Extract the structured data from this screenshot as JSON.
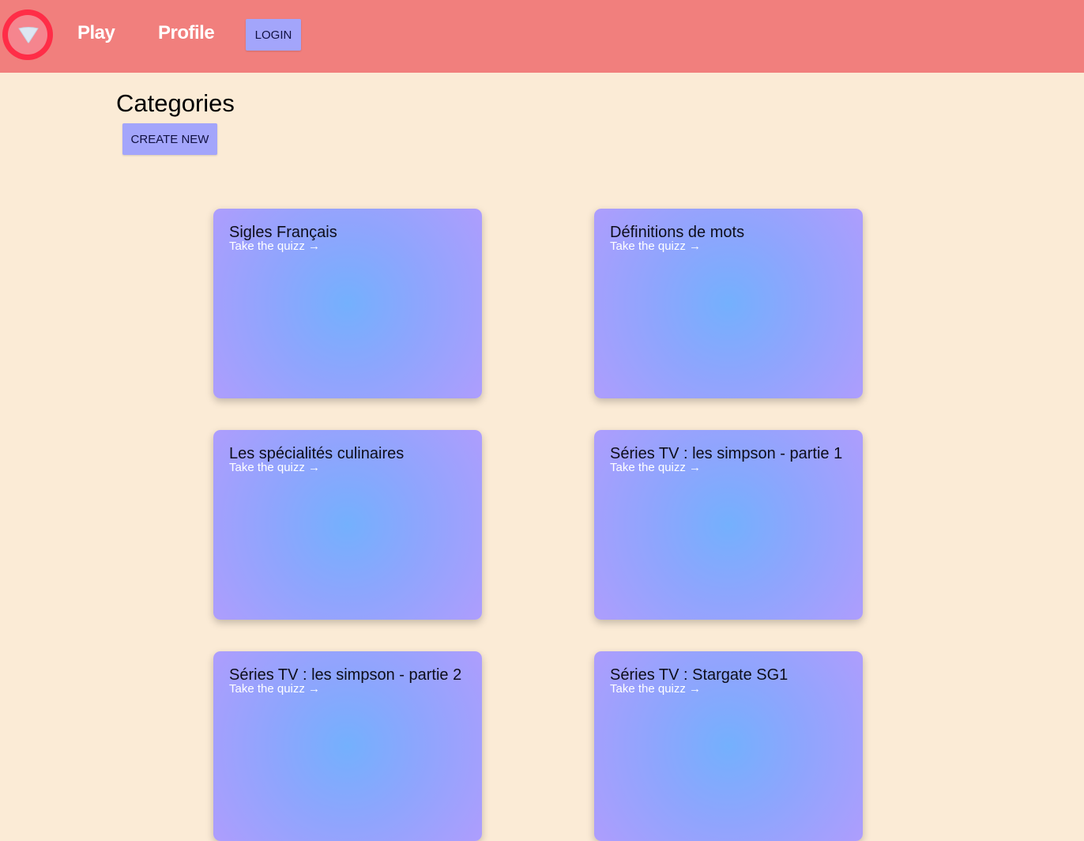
{
  "navbar": {
    "logo_icon": "triangle-down-icon",
    "play_label": "Play",
    "profile_label": "Profile",
    "login_label": "LOGIN",
    "colors": {
      "background": "#f17f7d",
      "logo_ring": "#ff2d47",
      "button": "#a3a5fb"
    }
  },
  "main": {
    "title": "Categories",
    "create_label": "CREATE NEW"
  },
  "categories": [
    {
      "title": "Sigles Français",
      "link": "Take the quizz →"
    },
    {
      "title": "Définitions de mots",
      "link": "Take the quizz →"
    },
    {
      "title": "Les spécialités culinaires",
      "link": "Take the quizz →"
    },
    {
      "title": "Séries TV : les simpson - partie 1",
      "link": "Take the quizz →"
    },
    {
      "title": "Séries TV : les simpson - partie 2",
      "link": "Take the quizz →"
    },
    {
      "title": "Séries TV : Stargate SG1",
      "link": "Take the quizz →"
    }
  ]
}
